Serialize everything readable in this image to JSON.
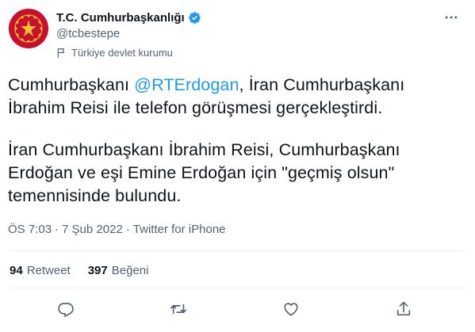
{
  "author": {
    "display_name": "T.C. Cumhurbaşkanlığı",
    "handle": "@tcbestepe",
    "label": "Türkiye devlet kurumu",
    "avatar_icon": "presidential-seal-icon",
    "verified_icon": "verified-badge-icon"
  },
  "tweet": {
    "text_part1_before": "Cumhurbaşkanı ",
    "mention": "@RTErdogan",
    "text_part1_after": ", İran Cumhurbaşkanı İbrahim Reisi ile telefon görüşmesi gerçekleştirdi.",
    "text_part2": "İran Cumhurbaşkanı İbrahim Reisi, Cumhurbaşkanı Erdoğan ve eşi Emine Erdoğan için \"geçmiş olsun\" temennisinde bulundu."
  },
  "meta": {
    "time": "ÖS 7:03",
    "date": "7 Şub 2022",
    "source": "Twitter for iPhone",
    "separator": "·"
  },
  "stats": {
    "retweets_count": "94",
    "retweets_label": "Retweet",
    "likes_count": "397",
    "likes_label": "Beğeni"
  },
  "actions": [
    "reply-icon",
    "retweet-icon",
    "like-icon",
    "share-icon"
  ],
  "colors": {
    "text": "#0f1419",
    "secondary": "#536471",
    "accent": "#1d9bf0",
    "avatar_bg": "#c8102e",
    "divider": "#eff3f4"
  }
}
